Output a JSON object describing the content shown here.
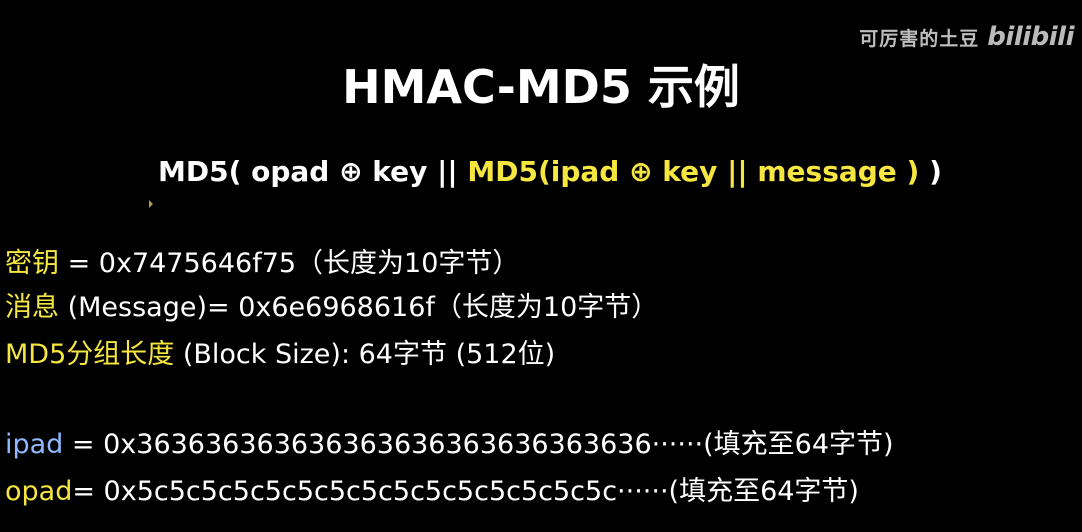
{
  "watermark": {
    "text": "可厉害的土豆",
    "logo": "bilibili"
  },
  "slide": {
    "title": "HMAC-MD5 示例",
    "formula": {
      "part1": "MD5( opad ⊕ key || ",
      "part2": "MD5(ipad ⊕ key || message )",
      "part3": " )"
    },
    "lines": [
      {
        "label": "密钥",
        "rest": " =  0x7475646f75（长度为10字节）"
      },
      {
        "label": "消息",
        "rest": " (Message)= 0x6e6968616f（长度为10字节）"
      },
      {
        "label": "MD5分组长度",
        "rest": " (Block Size): 64字节 (512位)"
      },
      {
        "label": "ipad",
        "rest": " = 0x363636363636363636363636363636······(填充至64字节)"
      },
      {
        "label": "opad",
        "rest": "= 0x5c5c5c5c5c5c5c5c5c5c5c5c5c5c5c······(填充至64字节)"
      }
    ]
  },
  "colors": {
    "background": "#000000",
    "text": "#ffffff",
    "highlight_yellow": "#f5e640",
    "highlight_blue": "#8fb8ff"
  }
}
